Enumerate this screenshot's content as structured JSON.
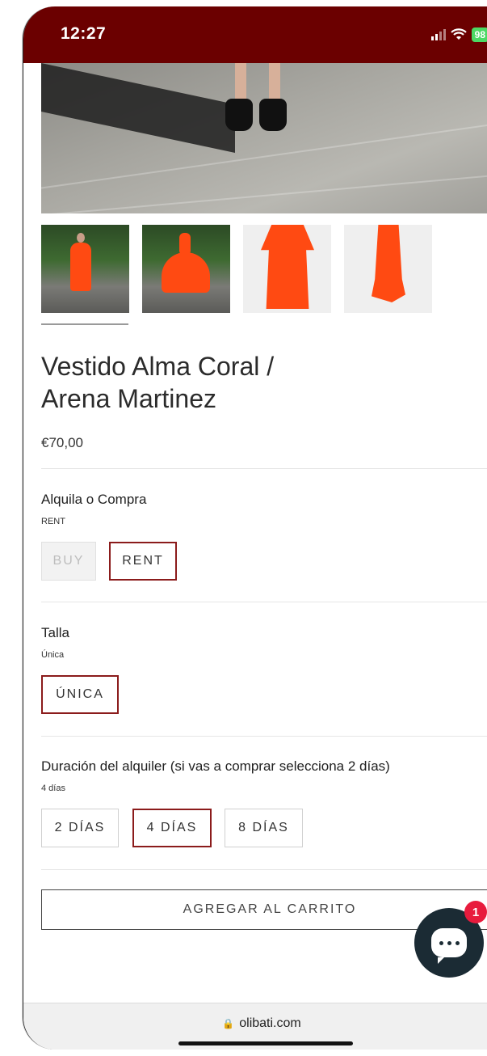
{
  "status_bar": {
    "time": "12:27",
    "battery": "98"
  },
  "product": {
    "title_line1": "Vestido Alma Coral /",
    "title_line2": "Arena Martinez",
    "price": "€70,00"
  },
  "options": {
    "mode": {
      "label": "Alquila o Compra",
      "selected": "RENT",
      "buttons": [
        "BUY",
        "RENT"
      ]
    },
    "size": {
      "label": "Talla",
      "selected": "Única",
      "buttons": [
        "ÚNICA"
      ]
    },
    "duration": {
      "label": "Duración del alquiler (si vas a comprar selecciona 2 días)",
      "selected": "4 días",
      "buttons": [
        "2 DÍAS",
        "4 DÍAS",
        "8 DÍAS"
      ]
    }
  },
  "cart": {
    "label": "AGREGAR AL CARRITO"
  },
  "chat": {
    "badge_count": "1"
  },
  "browser": {
    "url": "olibati.com"
  },
  "colors": {
    "status_bar": "#6b0000",
    "accent_border": "#8b1b1b",
    "chat_bg": "#1b2b34",
    "badge": "#e81b3d"
  }
}
